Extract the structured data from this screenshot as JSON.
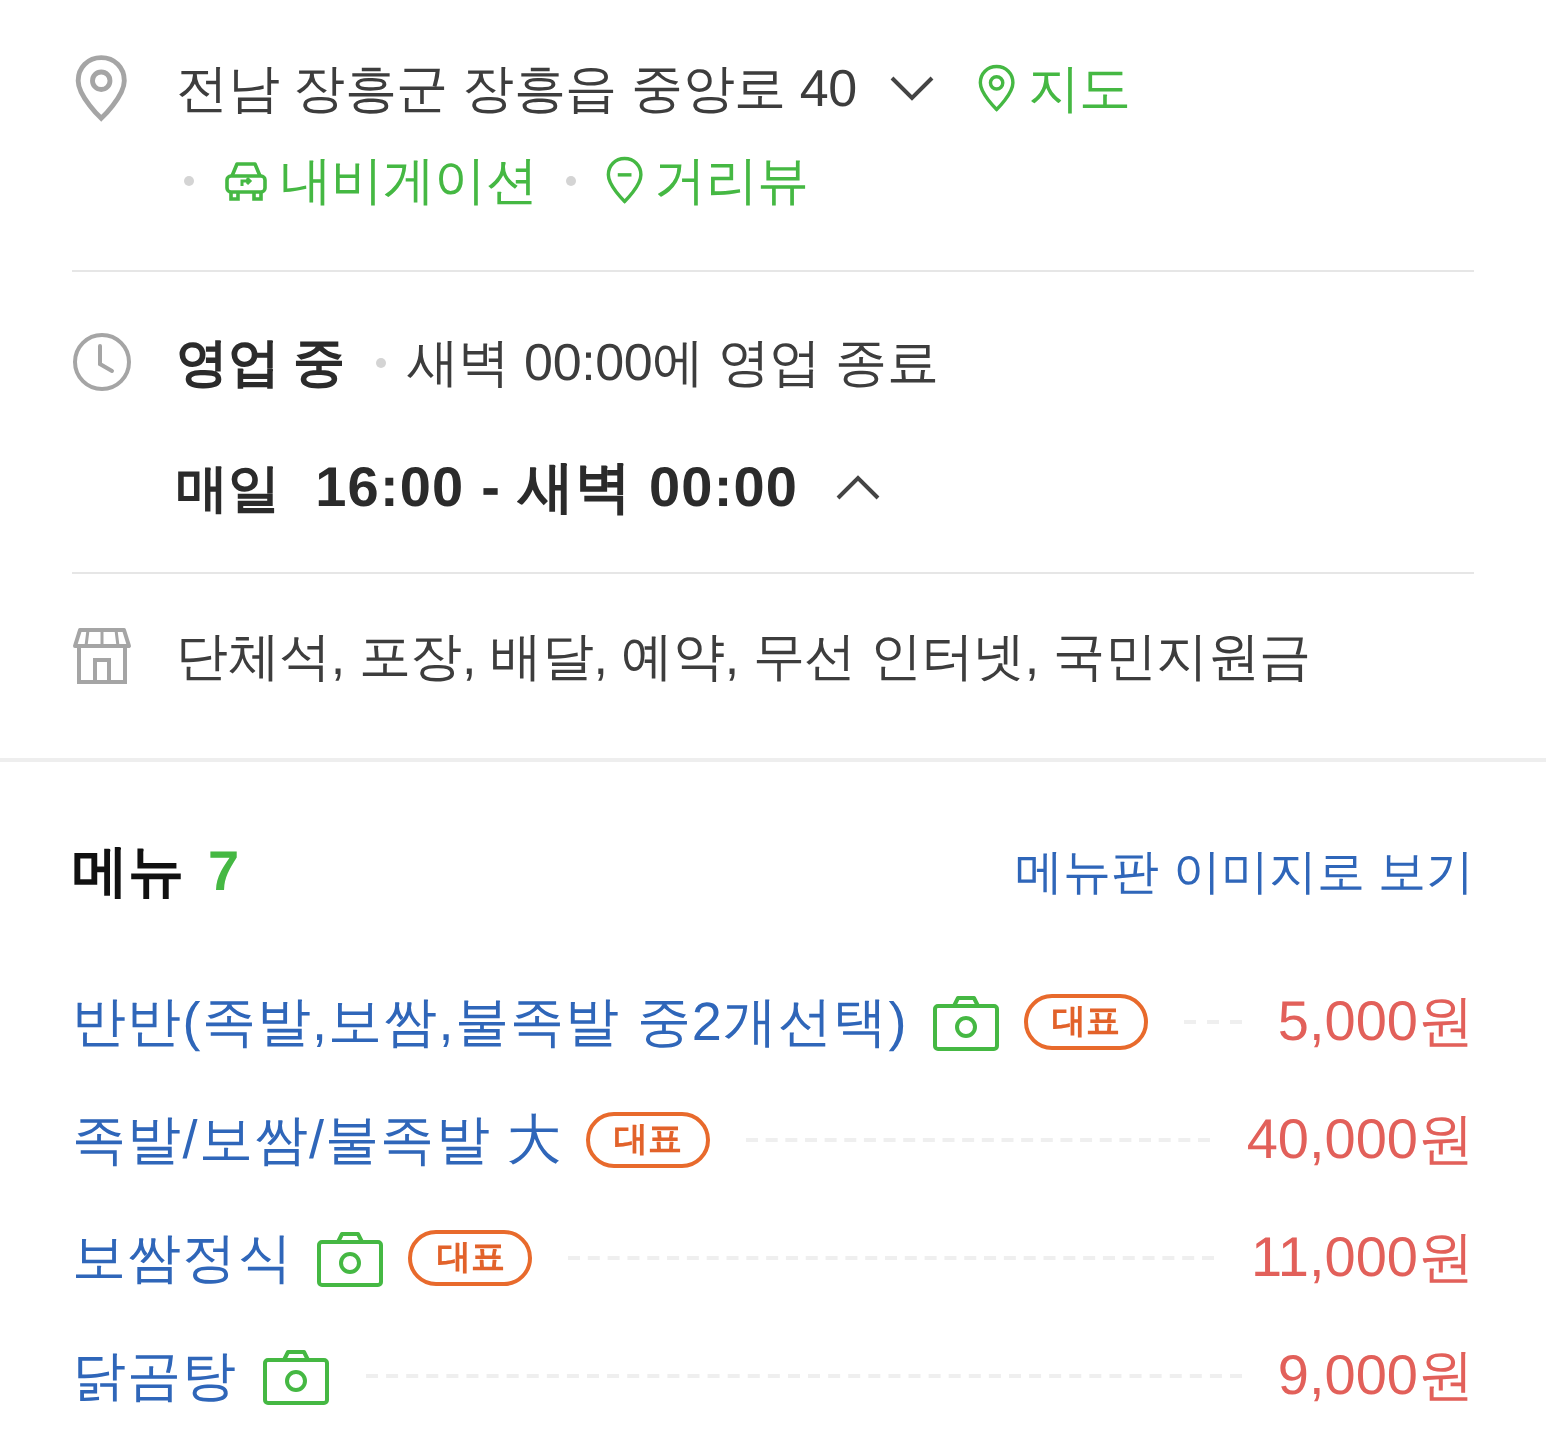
{
  "address": {
    "text": "전남 장흥군 장흥읍 중앙로 40",
    "expanded": false,
    "map_link": "지도",
    "links": [
      {
        "kind": "navigation",
        "label": "내비게이션"
      },
      {
        "kind": "street_view",
        "label": "거리뷰"
      }
    ]
  },
  "hours": {
    "status": "영업 중",
    "note": "새벽 00:00에 영업 종료",
    "expanded": true,
    "schedule": [
      {
        "day": "매일",
        "time": "16:00 - 새벽 00:00"
      }
    ]
  },
  "amenities": {
    "text": "단체석, 포장, 배달, 예약, 무선 인터넷, 국민지원금"
  },
  "menu": {
    "title": "메뉴",
    "count": "7",
    "image_link": "메뉴판 이미지로 보기",
    "items": [
      {
        "name": "반반(족발,보쌈,불족발 중2개선택)",
        "photo": true,
        "badge": "대표",
        "price": "5,000원"
      },
      {
        "name": "족발/보쌈/불족발 大",
        "photo": false,
        "badge": "대표",
        "price": "40,000원"
      },
      {
        "name": "보쌈정식",
        "photo": true,
        "badge": "대표",
        "price": "11,000원"
      },
      {
        "name": "닭곰탕",
        "photo": true,
        "price": "9,000원"
      }
    ]
  }
}
